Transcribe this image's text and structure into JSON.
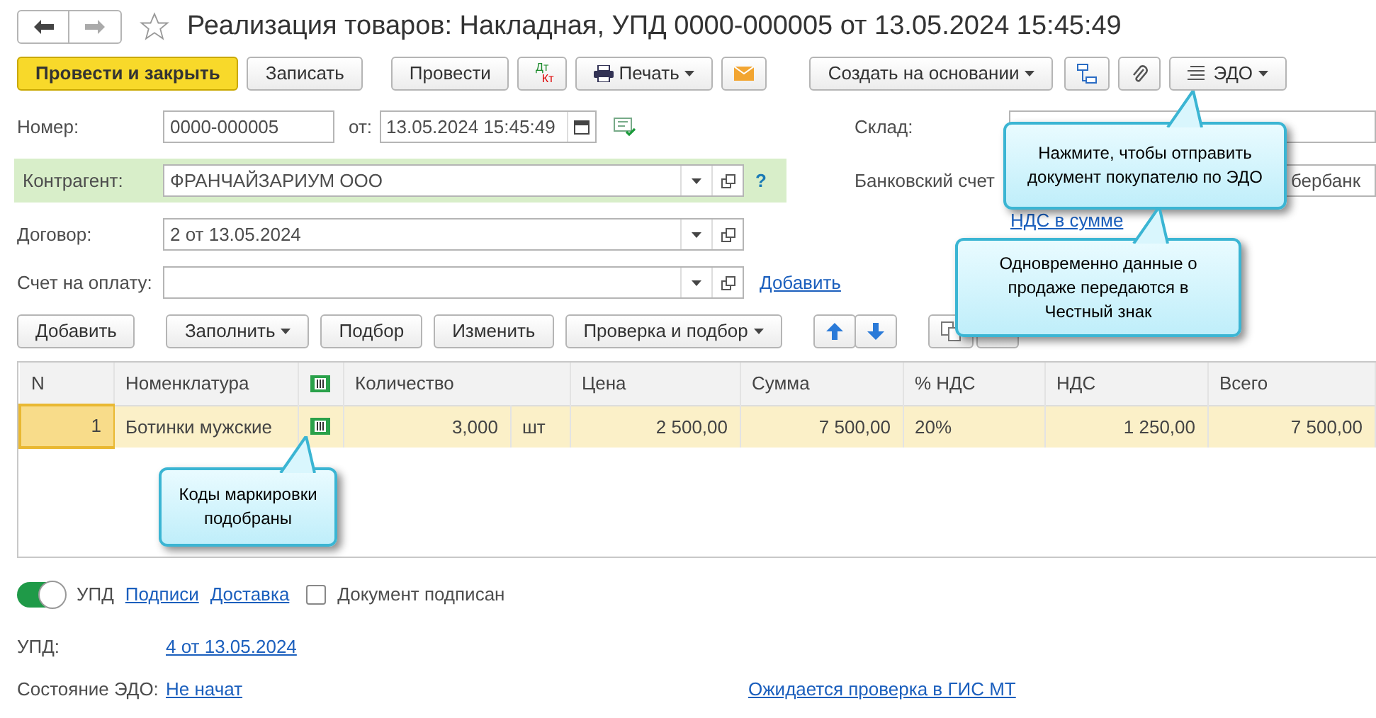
{
  "window": {
    "title": "Реализация товаров: Накладная, УПД 0000-000005 от 13.05.2024 15:45:49",
    "favorite": false
  },
  "toolbar": [
    {
      "kind": "primary",
      "label": "Провести и закрыть"
    },
    {
      "kind": "plain",
      "label": "Записать"
    },
    {
      "kind": "plain",
      "label": "Провести"
    },
    {
      "kind": "dtkt",
      "label": "Дт",
      "label2": "Кт"
    },
    {
      "kind": "print",
      "label": "Печать"
    },
    {
      "kind": "mail"
    },
    {
      "kind": "menu",
      "label": "Создать на основании"
    },
    {
      "kind": "structure"
    },
    {
      "kind": "clip"
    },
    {
      "kind": "edo",
      "label": "ЭДО"
    }
  ],
  "form": {
    "number_label": "Номер:",
    "number": "0000-000005",
    "date_label": "от:",
    "date": "13.05.2024 15:45:49",
    "counterparty_label": "Контрагент:",
    "counterparty": "ФРАНЧАЙЗАРИУМ ООО",
    "help": "?",
    "contract_label": "Договор:",
    "contract": "2 от 13.05.2024",
    "invoice_label": "Счет на оплату:",
    "invoice_add": "Добавить",
    "warehouse_label": "Склад:",
    "bank_label": "Банковский счет",
    "bank": "бербанк",
    "vat_link": "НДС в сумме"
  },
  "table_toolbar": [
    {
      "kind": "plain",
      "label": "Добавить"
    },
    {
      "kind": "menu",
      "label": "Заполнить"
    },
    {
      "kind": "plain",
      "label": "Подбор"
    },
    {
      "kind": "plain",
      "label": "Изменить"
    },
    {
      "kind": "menu",
      "label": "Проверка и подбор"
    },
    {
      "kind": "up"
    },
    {
      "kind": "down"
    },
    {
      "kind": "copy"
    },
    {
      "kind": "hidden"
    }
  ],
  "table": {
    "columns": [
      {
        "kind": "text",
        "label": "N"
      },
      {
        "kind": "text",
        "label": "Номенклатура"
      },
      {
        "kind": "mark"
      },
      {
        "kind": "text",
        "label": "Количество"
      },
      {
        "kind": "text",
        "label": "Цена"
      },
      {
        "kind": "text",
        "label": "Сумма"
      },
      {
        "kind": "text",
        "label": "% НДС"
      },
      {
        "kind": "text",
        "label": "НДС"
      },
      {
        "kind": "text",
        "label": "Всего"
      }
    ],
    "rows": [
      {
        "selected": true,
        "n": "1",
        "item": "Ботинки мужские",
        "marked": true,
        "qty": "3,000",
        "unit": "шт",
        "price": "2 500,00",
        "sum": "7 500,00",
        "vat_rate": "20%",
        "vat": "1 250,00",
        "total": "7 500,00"
      }
    ]
  },
  "footer": {
    "upd_on": true,
    "upd_label": "УПД",
    "links": [
      "Подписи",
      "Доставка"
    ],
    "signed": false,
    "signed_label": "Документ подписан",
    "upd_field_label": "УПД:",
    "upd_value": "4 от 13.05.2024",
    "state_label": "Состояние ЭДО:",
    "state": "Не начат",
    "check": "Ожидается проверка в ГИС МТ"
  },
  "callouts": [
    {
      "text": "Нажмите, чтобы отправить документ покупателю по ЭДО"
    },
    {
      "text": "Одновременно данные о продаже передаются в Честный знак"
    },
    {
      "text": "Коды маркировки подобраны"
    }
  ]
}
